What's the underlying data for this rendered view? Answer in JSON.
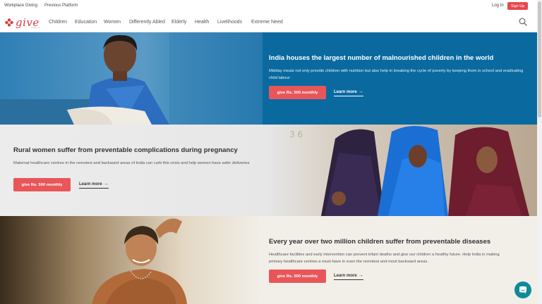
{
  "topbar": {
    "workplace_giving": "Workplace Giving",
    "previous_platform": "Previous Platform",
    "login": "Log In",
    "signup": "Sign Up"
  },
  "logo": {
    "text": "give",
    "sub": "INDIA",
    "brand_color": "#d63e43"
  },
  "nav": {
    "items": [
      "Children",
      "Education",
      "Women",
      "Differently Abled",
      "Elderly",
      "Health",
      "Livelihoods",
      "Extreme Need"
    ],
    "search_icon": "search-icon"
  },
  "sections": [
    {
      "heading": "India houses the largest number of malnourished children in the world",
      "description": "Midday meals not only provide children with nutrition but also help in breaking the cycle of poverty by keeping them in school and eradicating child labour",
      "cta": "give Rs. 500 monthly",
      "learn_more": "Learn more",
      "background": "#0a6aa0"
    },
    {
      "heading": "Rural women suffer from preventable complications during pregnancy",
      "description": "Maternal healthcare centres in the remotest and backward areas of India can curb this crisis and help women have safer deliveries",
      "cta": "give Rs. 500 monthly",
      "learn_more": "Learn more",
      "background": "#ebebeb"
    },
    {
      "heading": "Every year over two million children suffer from preventable diseases",
      "description": "Healthcare facilities and early intervention can prevent infant deaths and give our children a healthy future. Help India in making primary healthcare centres a must-have in even the remotest and most backward areas.",
      "cta": "give Rs. 500 monthly",
      "learn_more": "Learn more",
      "background": "#f2efe9"
    }
  ],
  "accent_color": "#e8565a",
  "chat_icon": "chat-icon"
}
